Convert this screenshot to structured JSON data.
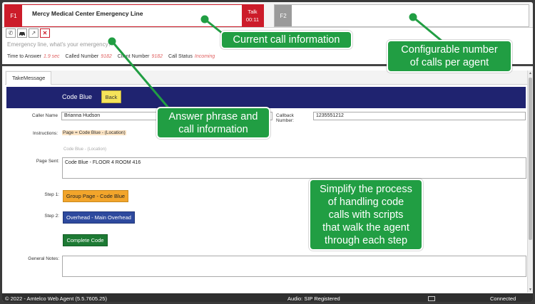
{
  "call_bar": {
    "slot1": {
      "key": "F1",
      "title": "Mercy Medical Center Emergency Line",
      "state": "Talk",
      "timer": "00:11"
    },
    "slot2": {
      "key": "F2"
    }
  },
  "controls": [
    "phone-icon",
    "car-icon",
    "pickup-icon",
    "close-icon"
  ],
  "answer_phrase": "Emergency line, what's your emergency?",
  "call_info": {
    "time_to_answer_label": "Time to Answer",
    "time_to_answer": "1.9 sec",
    "called_number_label": "Called Number",
    "called_number": "9182",
    "client_number_label": "Client Number",
    "client_number": "9182",
    "call_status_label": "Call Status",
    "call_status": "Incoming"
  },
  "tabs": [
    {
      "label": "TakeMessage"
    }
  ],
  "form": {
    "title": "Code Blue",
    "back_label": "Back",
    "caller_name_label": "Caller Name",
    "caller_name": "Brianna Hudson",
    "callback_label": "Callback Number:",
    "callback_number": "1235551212",
    "instructions_label": "Instructions:",
    "instructions_value": "Page = Code Blue - (Location)",
    "instructions_hint": "Code Blue - (Location)",
    "page_sent_label": "Page Sent:",
    "page_sent": "Code Blue - FLOOR 4 ROOM 416",
    "step1_label": "Step 1:",
    "step1_button": "Group Page - Code Blue",
    "step2_label": "Step 2:",
    "step2_button": "Overhead - Main Overhead",
    "complete_button": "Complete Code",
    "notes_label": "General Notes:",
    "notes": ""
  },
  "callouts": {
    "current": "Current call information",
    "config_line1": "Configurable number",
    "config_line2": "of calls per agent",
    "answer_line1": "Answer phrase and",
    "answer_line2": "call information",
    "simplify_line1": "Simplify the process",
    "simplify_line2": "of handling code",
    "simplify_line3": "calls with scripts",
    "simplify_line4": "that walk the agent",
    "simplify_line5": "through each step"
  },
  "status_bar": {
    "copyright": "© 2022 - Amtelco Web Agent   (5.5.7605.25)",
    "audio": "Audio: SIP Registered",
    "connection": "Connected"
  },
  "colors": {
    "accent_red": "#cc1c2a",
    "banner_navy": "#1f2370",
    "callout_green": "#219e43"
  }
}
